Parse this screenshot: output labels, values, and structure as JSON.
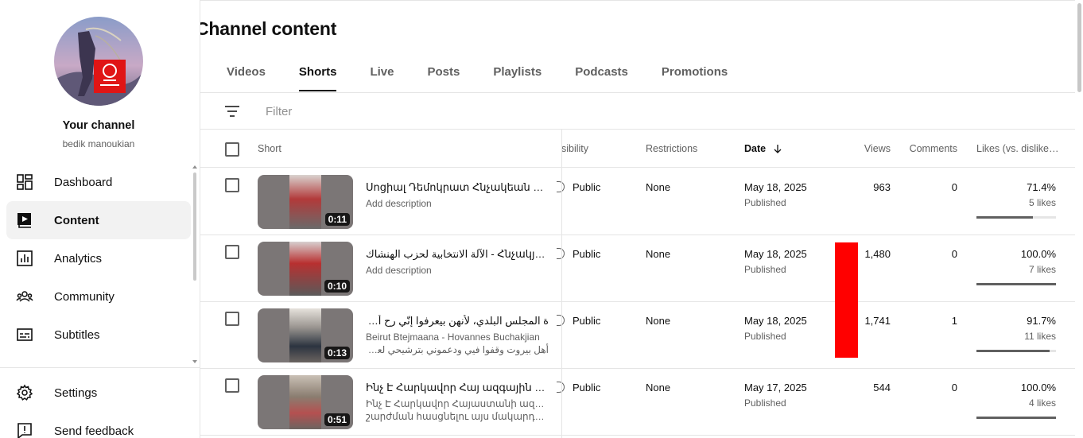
{
  "channel": {
    "title": "Your channel",
    "handle": "bedik manoukian"
  },
  "sidebar": {
    "items": [
      {
        "label": "Dashboard",
        "icon": "dashboard-icon"
      },
      {
        "label": "Content",
        "icon": "content-icon",
        "active": true
      },
      {
        "label": "Analytics",
        "icon": "analytics-icon"
      },
      {
        "label": "Community",
        "icon": "community-icon"
      },
      {
        "label": "Subtitles",
        "icon": "subtitles-icon"
      }
    ],
    "bottom": [
      {
        "label": "Settings",
        "icon": "gear-icon"
      },
      {
        "label": "Send feedback",
        "icon": "feedback-icon"
      }
    ]
  },
  "page": {
    "title": "Channel content",
    "tabs": [
      "Videos",
      "Shorts",
      "Live",
      "Posts",
      "Playlists",
      "Podcasts",
      "Promotions"
    ],
    "active_tab": "Shorts",
    "filter_placeholder": "Filter"
  },
  "table": {
    "headers": {
      "short": "Short",
      "visibility": "sibility",
      "restrictions": "Restrictions",
      "date": "Date",
      "views": "Views",
      "comments": "Comments",
      "likes": "Likes (vs. dislike…"
    },
    "rows": [
      {
        "title": "Սոցիալ Դեմոկրատ Հնչակեան կուս…",
        "description": [
          "Add description"
        ],
        "duration": "0:11",
        "visibility": "Public",
        "restrictions": "None",
        "date": "May 18, 2025",
        "status": "Published",
        "views": "963",
        "comments": "0",
        "likes_pct": "71.4%",
        "likes_count": "5 likes",
        "likes_ratio": 0.714
      },
      {
        "title": "الآلة الانتخابية لحزب الهنشاك - Հնչակյան կուս…",
        "description": [
          "Add description"
        ],
        "duration": "0:10",
        "visibility": "Public",
        "restrictions": "None",
        "date": "May 18, 2025",
        "status": "Published",
        "views": "1,480",
        "comments": "0",
        "likes_pct": "100.0%",
        "likes_count": "7 likes",
        "likes_ratio": 1.0
      },
      {
        "title": "ة المجلس البلدي، لأنهن بيعرفوا إنّي رح أوصّل صوتن",
        "description": [
          "Beirut Btejmaana - Hovannes Buchakjian",
          "أهل بيروت وقفوا فيي ودعموني بترشيحي لعضوية ال…"
        ],
        "duration": "0:13",
        "visibility": "Public",
        "restrictions": "None",
        "date": "May 18, 2025",
        "status": "Published",
        "views": "1,741",
        "comments": "1",
        "likes_pct": "91.7%",
        "likes_count": "11 likes",
        "likes_ratio": 0.917
      },
      {
        "title": "Ինչ Է Հարկավոր Հայ ազգային շարժ…",
        "description": [
          "Ինչ Է Հարկավոր Հայաստանի ազգային",
          "շարժման հասցնելու այս մակարդակին…"
        ],
        "duration": "0:51",
        "visibility": "Public",
        "restrictions": "None",
        "date": "May 17, 2025",
        "status": "Published",
        "views": "544",
        "comments": "0",
        "likes_pct": "100.0%",
        "likes_count": "4 likes",
        "likes_ratio": 1.0
      }
    ]
  },
  "colors": {
    "accent": "#0f0f0f",
    "secondary_text": "#606060",
    "overlay_red": "#ff0000"
  }
}
